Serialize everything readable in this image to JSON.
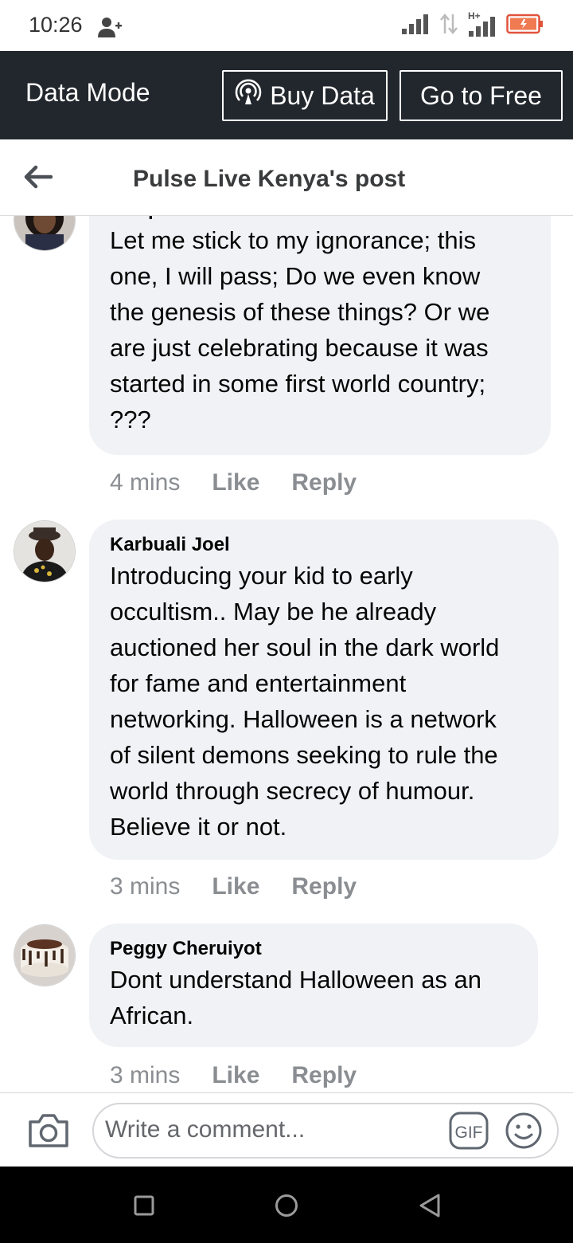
{
  "status_bar": {
    "time": "10:26",
    "network_label": "H+"
  },
  "data_bar": {
    "title": "Data Mode",
    "buy_label": "Buy Data",
    "free_label": "Go to Free"
  },
  "header": {
    "title": "Pulse Live Kenya's post"
  },
  "comments": [
    {
      "author": "Jacqueline Limo",
      "text": "Let me stick to my ignorance; this one, I will pass; Do we even know the genesis of these things? Or we are just celebrating because it was started in some first world country; ???",
      "lines": [
        "Let me stick to my ignorance; this",
        "one, I will pass; Do we even know",
        "the genesis of these things? Or we",
        "are just celebrating because it was",
        "started in some first world country;",
        "???"
      ],
      "time": "4 mins",
      "like": "Like",
      "reply": "Reply"
    },
    {
      "author": "Karbuali Joel",
      "lines": [
        "Introducing your kid to early",
        "occultism.. May be he already",
        "auctioned her soul in the dark world",
        "for fame and entertainment",
        "networking. Halloween is a network",
        "of silent demons seeking to rule the",
        "world through secrecy of humour.",
        "Believe it or not."
      ],
      "time": "3 mins",
      "like": "Like",
      "reply": "Reply"
    },
    {
      "author": "Peggy Cheruiyot",
      "lines": [
        "Dont understand Halloween as an",
        "African."
      ],
      "time": "3 mins",
      "like": "Like",
      "reply": "Reply"
    }
  ],
  "composer": {
    "placeholder": "Write a comment...",
    "gif_label": "GIF"
  },
  "colors": {
    "data_bar_bg": "#22272d",
    "bubble_bg": "#f0f2f5",
    "meta_text": "#8a8d91"
  }
}
